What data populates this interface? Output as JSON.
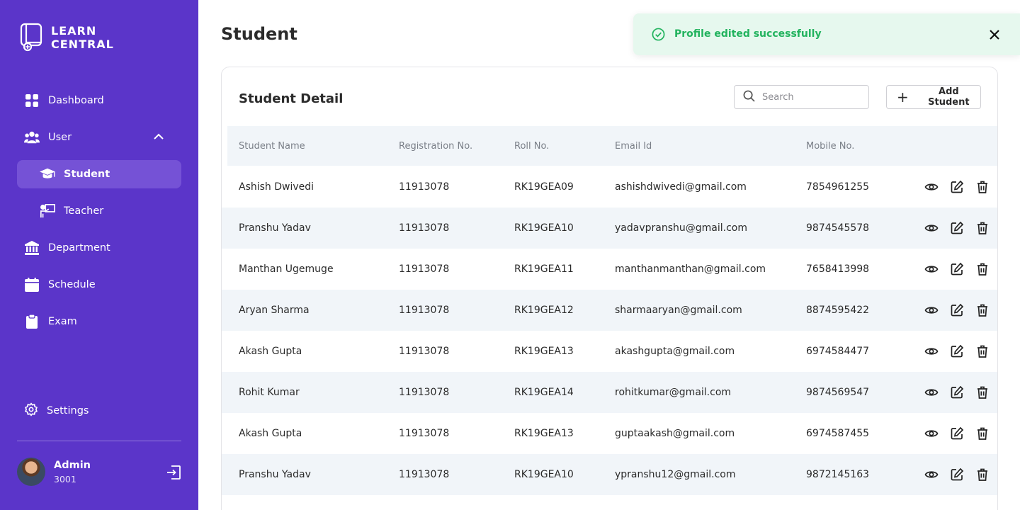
{
  "app": {
    "logo_line1": "LEARN",
    "logo_line2": "CENTRAL"
  },
  "sidebar": {
    "items": [
      {
        "label": "Dashboard",
        "icon": "grid-icon"
      },
      {
        "label": "User",
        "icon": "users-icon",
        "expanded": true
      },
      {
        "label": "Student",
        "icon": "graduation-cap-icon",
        "active": true
      },
      {
        "label": "Teacher",
        "icon": "teacher-icon"
      },
      {
        "label": "Department",
        "icon": "bank-icon"
      },
      {
        "label": "Schedule",
        "icon": "calendar-icon"
      },
      {
        "label": "Exam",
        "icon": "clipboard-icon"
      }
    ],
    "settings_label": "Settings",
    "profile": {
      "name": "Admin",
      "id": "3001"
    }
  },
  "page": {
    "title": "Student"
  },
  "toast": {
    "message": "Profile edited successfully",
    "color": "#22b35e",
    "background": "#e6f8ee"
  },
  "card": {
    "title": "Student Detail",
    "search_placeholder": "Search",
    "add_button_label": "Add Student"
  },
  "table": {
    "columns": [
      "Student Name",
      "Registration No.",
      "Roll No.",
      "Email Id",
      "Mobile No."
    ],
    "rows": [
      [
        "Ashish Dwivedi",
        "11913078",
        "RK19GEA09",
        "ashishdwivedi@gmail.com",
        "7854961255"
      ],
      [
        "Pranshu Yadav",
        "11913078",
        "RK19GEA10",
        "yadavpranshu@gmail.com",
        "9874545578"
      ],
      [
        "Manthan Ugemuge",
        "11913078",
        "RK19GEA11",
        "manthanmanthan@gmail.com",
        "7658413998"
      ],
      [
        "Aryan Sharma",
        "11913078",
        "RK19GEA12",
        "sharmaaryan@gmail.com",
        "8874595422"
      ],
      [
        "Akash Gupta",
        "11913078",
        "RK19GEA13",
        "akashgupta@gmail.com",
        "6974584477"
      ],
      [
        "Rohit Kumar",
        "11913078",
        "RK19GEA14",
        "rohitkumar@gmail.com",
        "9874569547"
      ],
      [
        "Akash Gupta",
        "11913078",
        "RK19GEA13",
        "guptaakash@gmail.com",
        "6974587455"
      ],
      [
        "Pranshu Yadav",
        "11913078",
        "RK19GEA10",
        "ypranshu12@gmail.com",
        "9872145163"
      ]
    ],
    "row_actions": [
      "view-icon",
      "edit-icon",
      "delete-icon"
    ]
  },
  "colors": {
    "sidebar": "#5b35c9",
    "active_item": "#7552d6",
    "table_header": "#f1f5f9"
  }
}
